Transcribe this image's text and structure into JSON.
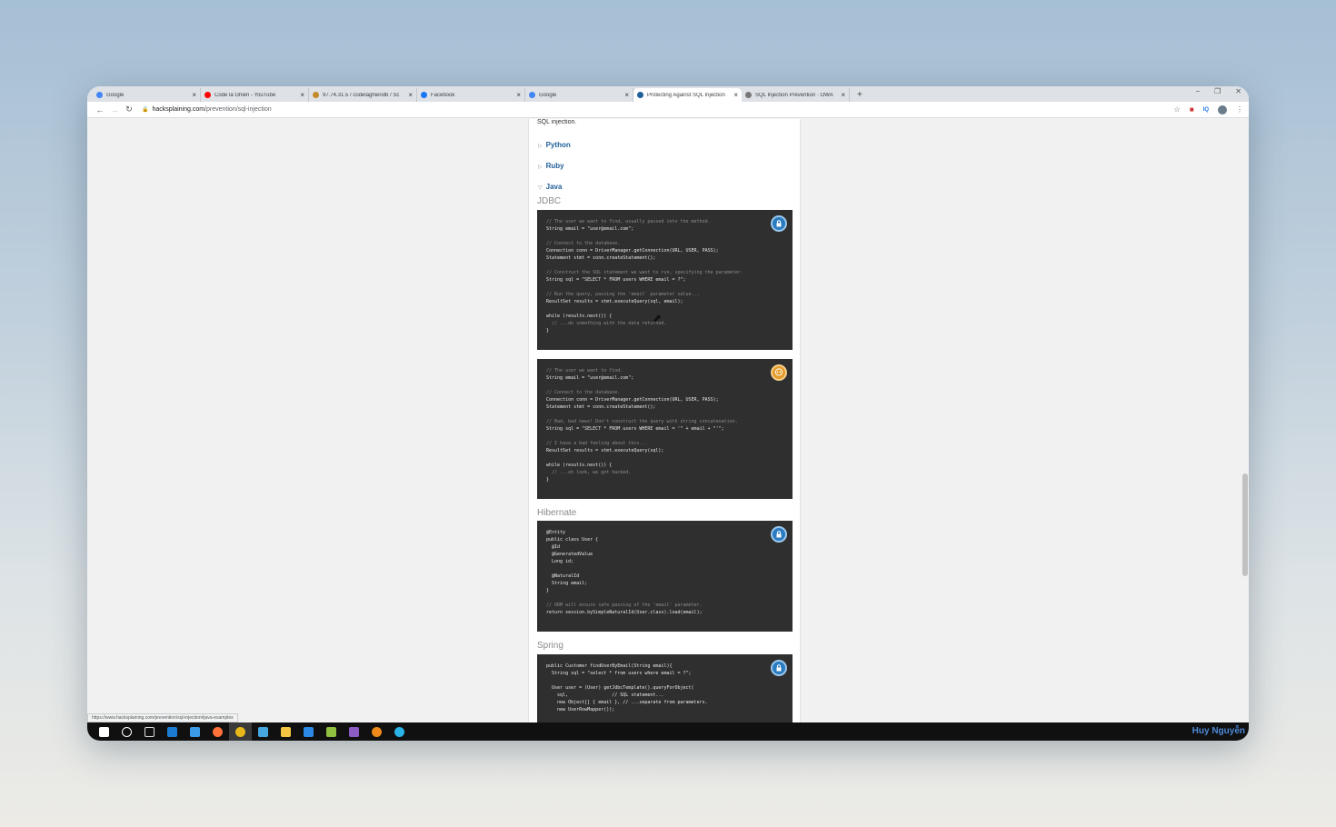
{
  "browser": {
    "tabs": [
      {
        "title": "Google",
        "favicon_color": "#4285f4",
        "active": false
      },
      {
        "title": "Code là Ghiền - YouTube",
        "favicon_color": "#ff0000",
        "active": false
      },
      {
        "title": "97.74.31.5 / codelaghiendb / Sc",
        "favicon_color": "#c48a2a",
        "active": false
      },
      {
        "title": "Facebook",
        "favicon_color": "#1877f2",
        "active": false
      },
      {
        "title": "Google",
        "favicon_color": "#4285f4",
        "active": false
      },
      {
        "title": "Protecting Against SQL Injection",
        "favicon_color": "#1f5f9a",
        "active": true
      },
      {
        "title": "SQL Injection Prevention · OWA",
        "favicon_color": "#777777",
        "active": false
      }
    ],
    "new_tab": "+",
    "window_controls": [
      "−",
      "❐",
      "✕"
    ],
    "url_domain": "hacksplaining.com",
    "url_path": "/prevention/sql-injection",
    "extension_label": "IQ"
  },
  "page": {
    "intro_text": "SQL injection.",
    "languages": [
      "Python",
      "Ruby",
      "Java"
    ],
    "sections": [
      {
        "heading": "JDBC",
        "blocks": [
          {
            "badge": "lock",
            "lines": [
              {
                "text": "// The user we want to find, usually passed into the method.",
                "kind": "cmt"
              },
              {
                "text": "String email = \"user@email.com\";",
                "kind": "kw"
              },
              {
                "text": "",
                "kind": "kw"
              },
              {
                "text": "// Connect to the database.",
                "kind": "cmt"
              },
              {
                "text": "Connection conn = DriverManager.getConnection(URL, USER, PASS);",
                "kind": "kw"
              },
              {
                "text": "Statement stmt = conn.createStatement();",
                "kind": "kw"
              },
              {
                "text": "",
                "kind": "kw"
              },
              {
                "text": "// Construct the SQL statement we want to run, specifying the parameter.",
                "kind": "cmt"
              },
              {
                "text": "String sql = \"SELECT * FROM users WHERE email = ?\";",
                "kind": "kw"
              },
              {
                "text": "",
                "kind": "kw"
              },
              {
                "text": "// Run the query, passing the 'email' parameter value...",
                "kind": "cmt"
              },
              {
                "text": "ResultSet results = stmt.executeQuery(sql, email);",
                "kind": "kw"
              },
              {
                "text": "",
                "kind": "kw"
              },
              {
                "text": "while (results.next()) {",
                "kind": "kw"
              },
              {
                "text": "  // ...do something with the data returned.",
                "kind": "cmt"
              },
              {
                "text": "}",
                "kind": "kw"
              }
            ]
          },
          {
            "badge": "skull",
            "lines": [
              {
                "text": "// The user we want to find.",
                "kind": "cmt"
              },
              {
                "text": "String email = \"user@email.com\";",
                "kind": "kw"
              },
              {
                "text": "",
                "kind": "kw"
              },
              {
                "text": "// Connect to the database.",
                "kind": "cmt"
              },
              {
                "text": "Connection conn = DriverManager.getConnection(URL, USER, PASS);",
                "kind": "kw"
              },
              {
                "text": "Statement stmt = conn.createStatement();",
                "kind": "kw"
              },
              {
                "text": "",
                "kind": "kw"
              },
              {
                "text": "// Bad, bad news! Don't construct the query with string concatenation.",
                "kind": "cmt"
              },
              {
                "text": "String sql = \"SELECT * FROM users WHERE email = '\" + email + \"'\";",
                "kind": "kw"
              },
              {
                "text": "",
                "kind": "kw"
              },
              {
                "text": "// I have a bad feeling about this...",
                "kind": "cmt"
              },
              {
                "text": "ResultSet results = stmt.executeQuery(sql);",
                "kind": "kw"
              },
              {
                "text": "",
                "kind": "kw"
              },
              {
                "text": "while (results.next()) {",
                "kind": "kw"
              },
              {
                "text": "  // ...oh look, we got hacked.",
                "kind": "cmt"
              },
              {
                "text": "}",
                "kind": "kw"
              }
            ]
          }
        ]
      },
      {
        "heading": "Hibernate",
        "blocks": [
          {
            "badge": "lock",
            "lines": [
              {
                "text": "@Entity",
                "kind": "kw"
              },
              {
                "text": "public class User {",
                "kind": "kw"
              },
              {
                "text": "  @Id",
                "kind": "kw"
              },
              {
                "text": "  @GeneratedValue",
                "kind": "kw"
              },
              {
                "text": "  Long id;",
                "kind": "kw"
              },
              {
                "text": "",
                "kind": "kw"
              },
              {
                "text": "  @NaturalId",
                "kind": "kw"
              },
              {
                "text": "  String email;",
                "kind": "kw"
              },
              {
                "text": "}",
                "kind": "kw"
              },
              {
                "text": "",
                "kind": "kw"
              },
              {
                "text": "// ORM will ensure safe passing of the 'email' parameter.",
                "kind": "cmt"
              },
              {
                "text": "return session.bySimpleNaturalId(User.class).load(email);",
                "kind": "kw"
              }
            ]
          }
        ]
      },
      {
        "heading": "Spring",
        "blocks": [
          {
            "badge": "lock",
            "lines": [
              {
                "text": "public Customer findUserByEmail(String email){",
                "kind": "kw"
              },
              {
                "text": "  String sql = \"select * from users where email = ?\";",
                "kind": "kw"
              },
              {
                "text": "",
                "kind": "kw"
              },
              {
                "text": "  User user = (User) getJdbcTemplate().queryForObject(",
                "kind": "kw"
              },
              {
                "text": "    sql,                // SQL statement...",
                "kind": "kw"
              },
              {
                "text": "    new Object[] { email }, // ...separate from parameters.",
                "kind": "kw"
              },
              {
                "text": "    new UserRowMapper());",
                "kind": "kw"
              }
            ]
          }
        ]
      }
    ]
  },
  "status_url": "https://www.hacksplaining.com/prevention/sql-injection#java-examples",
  "taskbar": {
    "icons": [
      "windows-start-icon",
      "cortana-search-icon",
      "task-view-icon",
      "edge-icon",
      "ie-icon",
      "firefox-icon",
      "chrome-icon",
      "dreamweaver-icon",
      "file-explorer-icon",
      "vscode-icon",
      "notepadpp-icon",
      "visual-studio-icon",
      "vlc-icon",
      "browser-icon"
    ],
    "icon_colors": [
      "#ffffff",
      "#ffffff",
      "#dddddd",
      "#1a7bd0",
      "#3c9be8",
      "#ff7139",
      "#e8b81a",
      "#46a6e0",
      "#f4c542",
      "#2c8ae6",
      "#90c040",
      "#8a5cc4",
      "#ee8a1a",
      "#2ab3e6"
    ],
    "user_name": "Huy Nguyễn"
  }
}
